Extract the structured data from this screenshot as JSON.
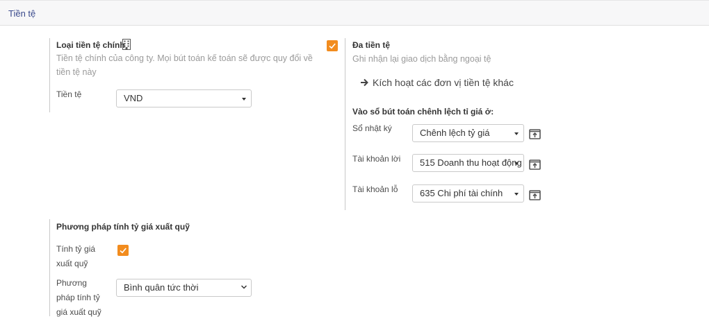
{
  "section": {
    "title": "Tiền tệ"
  },
  "main_currency": {
    "title": "Loại tiền tệ chính",
    "description": "Tiền tệ chính của công ty. Mọi bút toán kế toán sẽ được quy đổi về tiền tệ này",
    "field_label": "Tiền tệ",
    "value": "VND"
  },
  "multi_currency": {
    "title": "Đa tiền tệ",
    "description": "Ghi nhận lại giao dịch bằng ngoại tệ",
    "checked": true,
    "activate_link": "Kích hoạt các đơn vị tiền tệ khác",
    "subheading": "Vào sổ bút toán chênh lệch tỉ giá ở:",
    "journal_label": "Sổ nhật ký",
    "journal_value": "Chênh lệch tỷ giá",
    "gain_label": "Tài khoản lời",
    "gain_value": "515 Doanh thu hoạt động",
    "loss_label": "Tài khoản lỗ",
    "loss_value": "635 Chi phí tài chính"
  },
  "exchange_method": {
    "title": "Phương pháp tính tỷ giá xuất quỹ",
    "checkbox_label_1": "Tính tỷ giá",
    "checkbox_label_2": "xuất quỹ",
    "checked": true,
    "method_label_1": "Phương",
    "method_label_2": "pháp tính tỷ",
    "method_label_3": "giá xuất quỹ",
    "method_value": "Bình quân tức thời"
  },
  "colors": {
    "accent": "#f28c1e",
    "header_text": "#3a4a8c",
    "header_bg": "#f7f7f8"
  },
  "icons": [
    "building-icon",
    "check-icon",
    "arrow-right-icon",
    "external-link-icon",
    "caret-down-icon",
    "chevron-down-icon"
  ]
}
